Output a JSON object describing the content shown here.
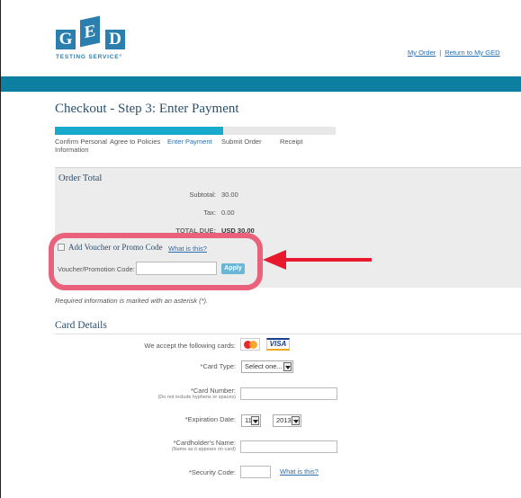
{
  "header": {
    "logo_letters": [
      "G",
      "E",
      "D"
    ],
    "logo_subtitle": "TESTING SERVICE°",
    "links": [
      "My Order",
      "Return to My GED"
    ],
    "separator": "|"
  },
  "colors": {
    "teal_bar": "#0d7fa1",
    "progress_fill": "#18aacd",
    "highlight": "#e9617a",
    "arrow": "#e8192c",
    "link": "#2a6fb0"
  },
  "page_title": "Checkout - Step 3: Enter Payment",
  "progress": {
    "fraction": 0.6,
    "steps": [
      {
        "label": "Confirm Personal Information",
        "active": false
      },
      {
        "label": "Agree to Policies",
        "active": false
      },
      {
        "label": "Enter Payment",
        "active": true
      },
      {
        "label": "Submit Order",
        "active": false
      },
      {
        "label": "Receipt",
        "active": false
      }
    ]
  },
  "order_total": {
    "heading": "Order Total",
    "subtotal_label": "Subtotal:",
    "subtotal_value": "30.00",
    "tax_label": "Tax:",
    "tax_value": "0.00",
    "due_label": "TOTAL DUE:",
    "due_value": "USD 30.00"
  },
  "voucher": {
    "title": "Add Voucher or Promo Code",
    "help_link": "What is this?",
    "code_label": "Voucher/Promotion Code:",
    "code_value": "",
    "apply_label": "Apply"
  },
  "required_note": "Required information is marked with an asterisk (*).",
  "card_details": {
    "heading": "Card Details",
    "accepted_label": "We accept the following cards:",
    "card_brands": [
      "mastercard-icon",
      "visa-icon"
    ],
    "visa_text": "VISA",
    "card_type_label": "*Card Type:",
    "card_type_value": "Select one...",
    "card_number_label": "*Card Number:",
    "card_number_hint": "(Do not include hyphens or spaces)",
    "card_number_value": "",
    "expiration_label": "*Expiration Date:",
    "exp_month": "11",
    "exp_year": "2013",
    "cardholder_label": "*Cardholder's Name:",
    "cardholder_hint": "(Name as it appears on card)",
    "cardholder_value": "",
    "security_label": "*Security Code:",
    "security_value": "",
    "security_help": "What is this?"
  }
}
